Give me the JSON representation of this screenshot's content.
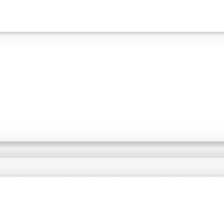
{
  "scene": {
    "subject": "air-conditioner-indoor-unit",
    "colors": {
      "background": "#ffffff",
      "panel": "#ffffff",
      "edge": "#c9c9c9",
      "seam": "#c6c6c6",
      "louver": "#ededed"
    }
  }
}
